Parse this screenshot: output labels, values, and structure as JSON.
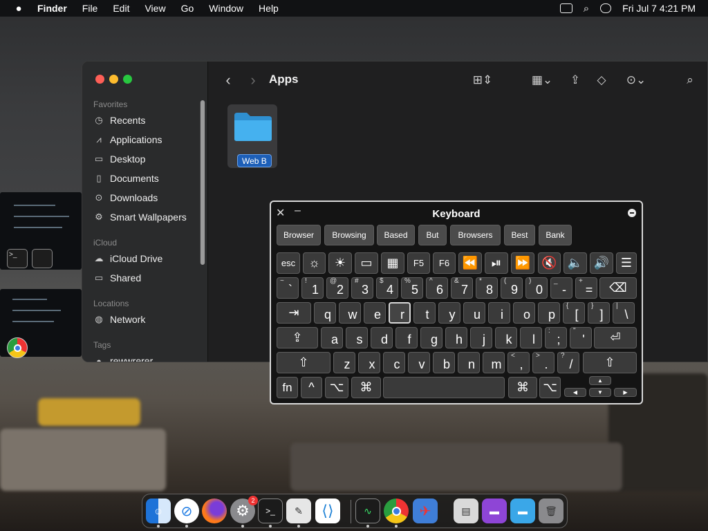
{
  "menubar": {
    "apple_icon": "apple-icon",
    "app_name": "Finder",
    "items": [
      "File",
      "Edit",
      "View",
      "Go",
      "Window",
      "Help"
    ],
    "datetime": "Fri Jul 7  4:21 PM"
  },
  "finder": {
    "title": "Apps",
    "sidebar": {
      "sections": {
        "favorites": "Favorites",
        "icloud": "iCloud",
        "locations": "Locations",
        "tags": "Tags"
      },
      "favorites": [
        "Recents",
        "Applications",
        "Desktop",
        "Documents",
        "Downloads",
        "Smart Wallpapers"
      ],
      "icloud": [
        "iCloud Drive",
        "Shared"
      ],
      "locations": [
        "Network"
      ],
      "tags": [
        "rewwrerer"
      ]
    },
    "items": [
      {
        "label": "Web B",
        "icon": "folder-icon",
        "color": "#3aa7e8"
      }
    ]
  },
  "keyboard": {
    "title": "Keyboard",
    "suggestions": [
      "Browser",
      "Browsing",
      "Based",
      "But",
      "Browsers",
      "Best",
      "Bank"
    ],
    "fn_row": {
      "esc": "esc",
      "f5": "F5",
      "f6": "F6"
    },
    "number_row": {
      "primary": [
        "`",
        "1",
        "2",
        "3",
        "4",
        "5",
        "6",
        "7",
        "8",
        "9",
        "0",
        "-",
        "="
      ],
      "secondary": [
        "~",
        "!",
        "@",
        "#",
        "$",
        "%",
        "^",
        "&",
        "*",
        "(",
        ")",
        "_",
        "+"
      ]
    },
    "row_q": {
      "primary": [
        "q",
        "w",
        "e",
        "r",
        "t",
        "y",
        "u",
        "i",
        "o",
        "p",
        "[",
        "]",
        "\\"
      ],
      "secondary": [
        "",
        "",
        "",
        "",
        "",
        "",
        "",
        "",
        "",
        "",
        "{",
        "}",
        "|"
      ]
    },
    "row_a": {
      "primary": [
        "a",
        "s",
        "d",
        "f",
        "g",
        "h",
        "j",
        "k",
        "l",
        ";",
        "'"
      ],
      "secondary": [
        "",
        "",
        "",
        "",
        "",
        "",
        "",
        "",
        "",
        ":",
        "\""
      ]
    },
    "row_z": {
      "primary": [
        "z",
        "x",
        "c",
        "v",
        "b",
        "n",
        "m",
        ",",
        ".",
        "/"
      ],
      "secondary": [
        "",
        "",
        "",
        "",
        "",
        "",
        "",
        "<",
        ">",
        "?"
      ]
    },
    "bottom": {
      "fn": "fn",
      "control": "^",
      "option": "⌥",
      "command": "⌘"
    },
    "highlighted_key": "r"
  },
  "dock": {
    "apps": [
      "finder-icon",
      "safari-icon",
      "firefox-icon",
      "system-settings-icon",
      "terminal-icon",
      "script-editor-icon",
      "vscode-icon",
      "activity-monitor-icon",
      "chrome-icon",
      "rocket-typist-icon",
      "files-icon",
      "downloads-folder-icon",
      "apps-folder-icon",
      "trash-icon"
    ],
    "settings_badge": "2"
  }
}
